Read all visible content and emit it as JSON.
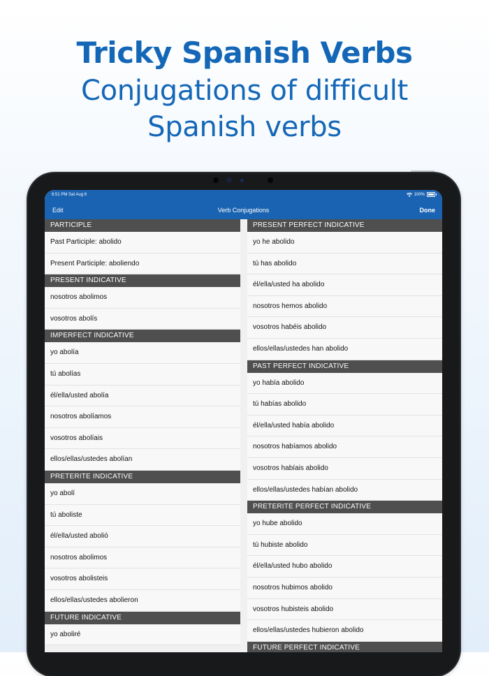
{
  "promo": {
    "title": "Tricky Spanish Verbs",
    "subtitle_line1": "Conjugations of difficult",
    "subtitle_line2": "Spanish verbs"
  },
  "status_bar": {
    "time": "6:51 PM   Sat Aug 6",
    "battery": "100%",
    "wifi_icon": "wifi-icon",
    "battery_icon": "battery-icon"
  },
  "nav": {
    "edit": "Edit",
    "title": "Verb Conjugations",
    "done": "Done"
  },
  "colors": {
    "brand_blue": "#1a63b2",
    "promo_text": "#1467b7",
    "section_header_bg": "#4f4f4f"
  },
  "left_sections": [
    {
      "header": "PARTICIPLE",
      "rows": [
        "Past Participle: abolido",
        "Present Participle: aboliendo"
      ]
    },
    {
      "header": "PRESENT INDICATIVE",
      "rows": [
        "nosotros abolimos",
        "vosotros abolís"
      ]
    },
    {
      "header": "IMPERFECT INDICATIVE",
      "rows": [
        "yo abolía",
        "tú abolías",
        "él/ella/usted abolía",
        "nosotros abolíamos",
        "vosotros abolíais",
        "ellos/ellas/ustedes abolían"
      ]
    },
    {
      "header": "PRETERITE INDICATIVE",
      "rows": [
        "yo abolí",
        "tú aboliste",
        "él/ella/usted abolió",
        "nosotros abolimos",
        "vosotros abolisteis",
        "ellos/ellas/ustedes abolieron"
      ]
    },
    {
      "header": "FUTURE INDICATIVE",
      "rows": [
        "yo aboliré"
      ]
    }
  ],
  "right_sections": [
    {
      "header": "PRESENT PERFECT INDICATIVE",
      "rows": [
        "yo he abolido",
        "tú has abolido",
        "él/ella/usted ha abolido",
        "nosotros hemos abolido",
        "vosotros habéis abolido",
        "ellos/ellas/ustedes han abolido"
      ]
    },
    {
      "header": "PAST PERFECT INDICATIVE",
      "rows": [
        "yo había abolido",
        "tú habías abolido",
        "él/ella/usted había abolido",
        "nosotros habíamos abolido",
        "vosotros habíais abolido",
        "ellos/ellas/ustedes habían abolido"
      ]
    },
    {
      "header": "PRETERITE PERFECT INDICATIVE",
      "rows": [
        "yo hube abolido",
        "tú hubiste abolido",
        "él/ella/usted hubo abolido",
        "nosotros hubimos abolido",
        "vosotros hubisteis abolido",
        "ellos/ellas/ustedes hubieron abolido"
      ]
    },
    {
      "header": "FUTURE PERFECT INDICATIVE",
      "rows": []
    }
  ]
}
